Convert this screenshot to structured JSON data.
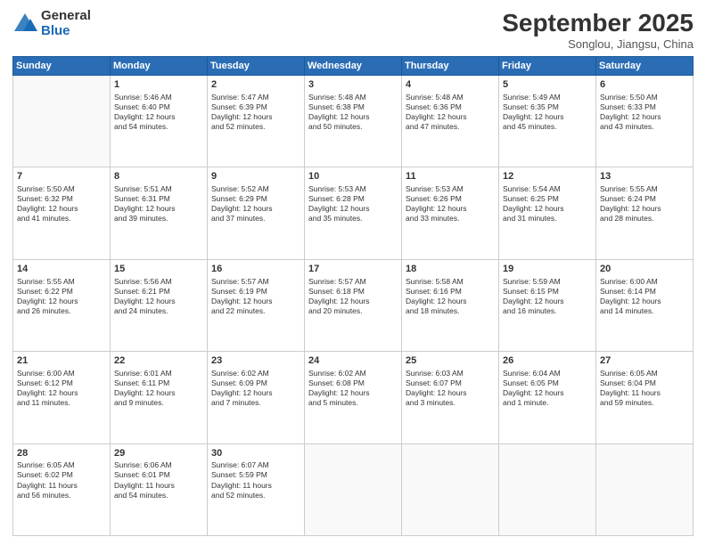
{
  "logo": {
    "general": "General",
    "blue": "Blue"
  },
  "header": {
    "month": "September 2025",
    "location": "Songlou, Jiangsu, China"
  },
  "days": [
    "Sunday",
    "Monday",
    "Tuesday",
    "Wednesday",
    "Thursday",
    "Friday",
    "Saturday"
  ],
  "weeks": [
    [
      {
        "day": "",
        "info": ""
      },
      {
        "day": "1",
        "info": "Sunrise: 5:46 AM\nSunset: 6:40 PM\nDaylight: 12 hours\nand 54 minutes."
      },
      {
        "day": "2",
        "info": "Sunrise: 5:47 AM\nSunset: 6:39 PM\nDaylight: 12 hours\nand 52 minutes."
      },
      {
        "day": "3",
        "info": "Sunrise: 5:48 AM\nSunset: 6:38 PM\nDaylight: 12 hours\nand 50 minutes."
      },
      {
        "day": "4",
        "info": "Sunrise: 5:48 AM\nSunset: 6:36 PM\nDaylight: 12 hours\nand 47 minutes."
      },
      {
        "day": "5",
        "info": "Sunrise: 5:49 AM\nSunset: 6:35 PM\nDaylight: 12 hours\nand 45 minutes."
      },
      {
        "day": "6",
        "info": "Sunrise: 5:50 AM\nSunset: 6:33 PM\nDaylight: 12 hours\nand 43 minutes."
      }
    ],
    [
      {
        "day": "7",
        "info": "Sunrise: 5:50 AM\nSunset: 6:32 PM\nDaylight: 12 hours\nand 41 minutes."
      },
      {
        "day": "8",
        "info": "Sunrise: 5:51 AM\nSunset: 6:31 PM\nDaylight: 12 hours\nand 39 minutes."
      },
      {
        "day": "9",
        "info": "Sunrise: 5:52 AM\nSunset: 6:29 PM\nDaylight: 12 hours\nand 37 minutes."
      },
      {
        "day": "10",
        "info": "Sunrise: 5:53 AM\nSunset: 6:28 PM\nDaylight: 12 hours\nand 35 minutes."
      },
      {
        "day": "11",
        "info": "Sunrise: 5:53 AM\nSunset: 6:26 PM\nDaylight: 12 hours\nand 33 minutes."
      },
      {
        "day": "12",
        "info": "Sunrise: 5:54 AM\nSunset: 6:25 PM\nDaylight: 12 hours\nand 31 minutes."
      },
      {
        "day": "13",
        "info": "Sunrise: 5:55 AM\nSunset: 6:24 PM\nDaylight: 12 hours\nand 28 minutes."
      }
    ],
    [
      {
        "day": "14",
        "info": "Sunrise: 5:55 AM\nSunset: 6:22 PM\nDaylight: 12 hours\nand 26 minutes."
      },
      {
        "day": "15",
        "info": "Sunrise: 5:56 AM\nSunset: 6:21 PM\nDaylight: 12 hours\nand 24 minutes."
      },
      {
        "day": "16",
        "info": "Sunrise: 5:57 AM\nSunset: 6:19 PM\nDaylight: 12 hours\nand 22 minutes."
      },
      {
        "day": "17",
        "info": "Sunrise: 5:57 AM\nSunset: 6:18 PM\nDaylight: 12 hours\nand 20 minutes."
      },
      {
        "day": "18",
        "info": "Sunrise: 5:58 AM\nSunset: 6:16 PM\nDaylight: 12 hours\nand 18 minutes."
      },
      {
        "day": "19",
        "info": "Sunrise: 5:59 AM\nSunset: 6:15 PM\nDaylight: 12 hours\nand 16 minutes."
      },
      {
        "day": "20",
        "info": "Sunrise: 6:00 AM\nSunset: 6:14 PM\nDaylight: 12 hours\nand 14 minutes."
      }
    ],
    [
      {
        "day": "21",
        "info": "Sunrise: 6:00 AM\nSunset: 6:12 PM\nDaylight: 12 hours\nand 11 minutes."
      },
      {
        "day": "22",
        "info": "Sunrise: 6:01 AM\nSunset: 6:11 PM\nDaylight: 12 hours\nand 9 minutes."
      },
      {
        "day": "23",
        "info": "Sunrise: 6:02 AM\nSunset: 6:09 PM\nDaylight: 12 hours\nand 7 minutes."
      },
      {
        "day": "24",
        "info": "Sunrise: 6:02 AM\nSunset: 6:08 PM\nDaylight: 12 hours\nand 5 minutes."
      },
      {
        "day": "25",
        "info": "Sunrise: 6:03 AM\nSunset: 6:07 PM\nDaylight: 12 hours\nand 3 minutes."
      },
      {
        "day": "26",
        "info": "Sunrise: 6:04 AM\nSunset: 6:05 PM\nDaylight: 12 hours\nand 1 minute."
      },
      {
        "day": "27",
        "info": "Sunrise: 6:05 AM\nSunset: 6:04 PM\nDaylight: 11 hours\nand 59 minutes."
      }
    ],
    [
      {
        "day": "28",
        "info": "Sunrise: 6:05 AM\nSunset: 6:02 PM\nDaylight: 11 hours\nand 56 minutes."
      },
      {
        "day": "29",
        "info": "Sunrise: 6:06 AM\nSunset: 6:01 PM\nDaylight: 11 hours\nand 54 minutes."
      },
      {
        "day": "30",
        "info": "Sunrise: 6:07 AM\nSunset: 5:59 PM\nDaylight: 11 hours\nand 52 minutes."
      },
      {
        "day": "",
        "info": ""
      },
      {
        "day": "",
        "info": ""
      },
      {
        "day": "",
        "info": ""
      },
      {
        "day": "",
        "info": ""
      }
    ]
  ]
}
